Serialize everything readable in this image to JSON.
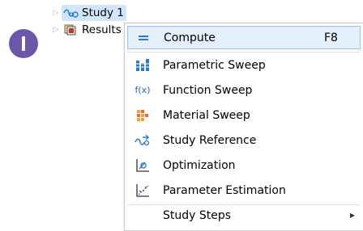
{
  "tree": {
    "study": {
      "label": "Study 1",
      "icon": "study-icon"
    },
    "results": {
      "label": "Results",
      "icon": "results-icon"
    }
  },
  "menu": {
    "items": [
      {
        "label": "Compute",
        "shortcut": "F8",
        "icon": "compute-icon"
      },
      {
        "label": "Parametric Sweep",
        "icon": "parametric-sweep-icon"
      },
      {
        "label": "Function Sweep",
        "icon": "function-sweep-icon",
        "icon_text": "f(x)"
      },
      {
        "label": "Material Sweep",
        "icon": "material-sweep-icon"
      },
      {
        "label": "Study Reference",
        "icon": "study-reference-icon"
      },
      {
        "label": "Optimization",
        "icon": "optimization-icon"
      },
      {
        "label": "Parameter Estimation",
        "icon": "parameter-estimation-icon"
      },
      {
        "label": "Study Steps",
        "icon": "study-steps-icon",
        "submenu": true
      }
    ]
  },
  "colors": {
    "badge": "#6b57a7",
    "selection": "#cfe6fb",
    "menu_highlight": "#e3effa",
    "accent_blue": "#2e7bc6"
  }
}
